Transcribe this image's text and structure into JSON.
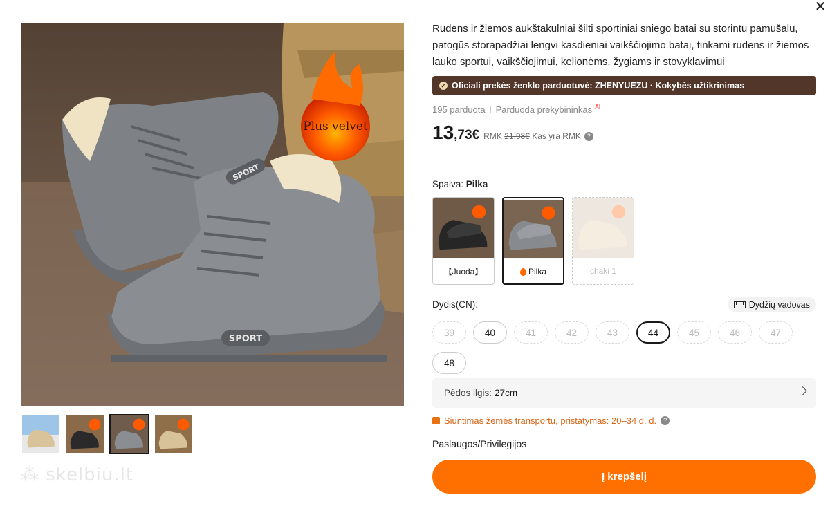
{
  "product": {
    "title": "Rudens ir žiemos aukštakulniai šilti sportiniai sniego batai su storintu pamušalu, patogūs storapadžiai lengvi kasdieniai vaikščiojimo batai, tinkami rudens ir žiemos lauko sportui, vaikščiojimui, kelionėms, žygiams ir stovyklavimui",
    "store_badge": "Oficiali prekės ženklo parduotuvė: ZHENYUEZU · Kokybės užtikrinimas",
    "sold": "195 parduota",
    "seller": "Parduoda prekybininkas",
    "ai_tag": "AI",
    "price_int": "13",
    "price_dec": ",73€",
    "old_price_prefix": "RMK",
    "old_price": "21,98€",
    "rmk_question": "Kas yra RMK",
    "help_icon": "?"
  },
  "image": {
    "badge_text": "Plus velvet",
    "sport_text": "SPORT",
    "watermark": "skelbiu.lt"
  },
  "color": {
    "label": "Spalva:",
    "selected": "Pilka",
    "options": [
      {
        "label": "【Juoda】"
      },
      {
        "label": "Pilka"
      },
      {
        "label": "chaki 1"
      }
    ]
  },
  "size": {
    "label": "Dydis(CN):",
    "guide": "Dydžių vadovas",
    "options": [
      {
        "label": "39"
      },
      {
        "label": "40"
      },
      {
        "label": "41"
      },
      {
        "label": "42"
      },
      {
        "label": "43"
      },
      {
        "label": "44"
      },
      {
        "label": "45"
      },
      {
        "label": "46"
      },
      {
        "label": "47"
      },
      {
        "label": "48"
      }
    ]
  },
  "foot_length": {
    "label": "Pėdos ilgis:",
    "value": "27cm"
  },
  "shipping": "Siuntimas žemės transportu, pristatymas: 20–34 d. d.",
  "services": "Paslaugos/Privilegijos",
  "cart_button": "Į krepšelį",
  "close_icon": "✕"
}
